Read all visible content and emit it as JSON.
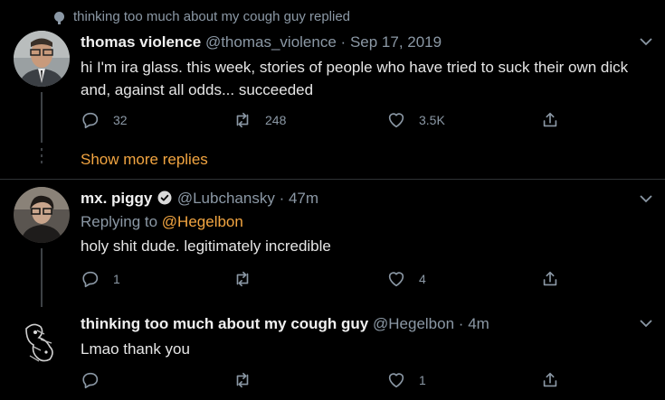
{
  "context": {
    "text": "thinking too much about my cough guy replied"
  },
  "tweets": [
    {
      "name": "thomas violence",
      "handle": "@thomas_violence",
      "sep": "·",
      "date": "Sep 17, 2019",
      "text": "hi I'm ira glass. this week, stories of people who have tried to suck their own dick and, against all odds... succeeded",
      "reply_count": "32",
      "retweet_count": "248",
      "like_count": "3.5K"
    },
    {
      "name": "mx. piggy",
      "handle": "@Lubchansky",
      "sep": "·",
      "date": "47m",
      "replying_prefix": "Replying to",
      "replying_to": "@Hegelbon",
      "text": "holy shit dude. legitimately incredible",
      "reply_count": "1",
      "retweet_count": "",
      "like_count": "4"
    },
    {
      "name": "thinking too much about my cough guy",
      "handle": "@Hegelbon",
      "sep": "·",
      "date": "4m",
      "text": "Lmao thank you",
      "reply_count": "",
      "retweet_count": "",
      "like_count": "1"
    }
  ],
  "show_more": "Show more replies",
  "colors": {
    "background": "#000000",
    "accent": "#f2a541",
    "muted": "#8b98a5",
    "text": "#e6e6e6"
  }
}
